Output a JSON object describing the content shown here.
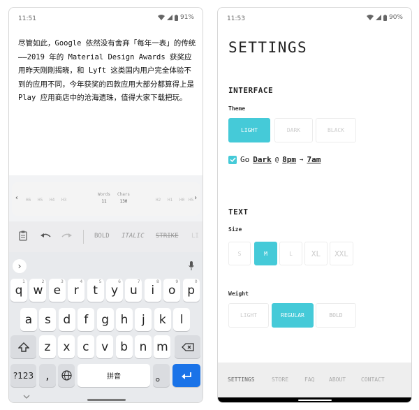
{
  "left": {
    "status": {
      "time": "11:51",
      "battery": "91%"
    },
    "editor": {
      "text": "尽管如此，Google 依然没有舍弃「每年一表」的传统——2019 年的 Material Design Awards 获奖应用昨天刚刚揭晓，和 Lyft 这类国内用户完全体验不到的应用不同，今年获奖的四款应用大部分都算得上是 Play 应用商店中的沧海遗珠，值得大家下载把玩。"
    },
    "stats": {
      "left_headers": [
        "H6",
        "H5",
        "H4",
        "H3"
      ],
      "right_headers": [
        "H2",
        "H1",
        "H0",
        "H5"
      ],
      "words_label": "Words",
      "words_value": "11",
      "chars_label": "Chars",
      "chars_value": "130"
    },
    "toolbar": {
      "bold": "BOLD",
      "italic": "ITALIC",
      "strike": "STRIKE",
      "more": "LI"
    },
    "keyboard": {
      "row1": [
        "q",
        "w",
        "e",
        "r",
        "t",
        "y",
        "u",
        "i",
        "o",
        "p"
      ],
      "row1_hints": [
        "1",
        "2",
        "3",
        "4",
        "5",
        "6",
        "7",
        "8",
        "9",
        "0"
      ],
      "row2": [
        "a",
        "s",
        "d",
        "f",
        "g",
        "h",
        "j",
        "k",
        "l"
      ],
      "row3": [
        "z",
        "x",
        "c",
        "v",
        "b",
        "n",
        "m"
      ],
      "num_key": "?123",
      "comma_key": ",",
      "space_label": "拼音",
      "period_key": "。"
    }
  },
  "right": {
    "status": {
      "time": "11:53",
      "battery": "90%"
    },
    "title": "SETTINGS",
    "interface": {
      "heading": "INTERFACE",
      "theme_label": "Theme",
      "themes": [
        "LIGHT",
        "DARK",
        "BLACK"
      ],
      "selected_theme": "LIGHT",
      "go_text": "Go",
      "go_mode": "Dark",
      "at": "@",
      "from_time": "8pm",
      "arrow": "→",
      "to_time": "7am"
    },
    "text": {
      "heading": "TEXT",
      "size_label": "Size",
      "sizes": [
        "S",
        "M",
        "L",
        "XL",
        "XXL"
      ],
      "selected_size": "M",
      "weight_label": "Weight",
      "weights": [
        "LIGHT",
        "REGULAR",
        "BOLD"
      ],
      "selected_weight": "REGULAR"
    },
    "nav": [
      "SETTINGS",
      "STORE",
      "FAQ",
      "ABOUT",
      "CONTACT"
    ]
  },
  "colors": {
    "accent": "#45cad8",
    "enter": "#1a73e8"
  }
}
